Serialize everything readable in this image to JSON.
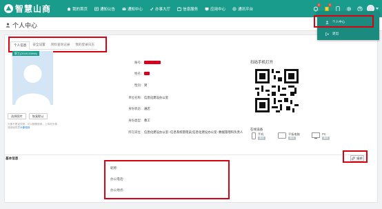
{
  "app": {
    "logo_text": "智慧山商",
    "logo_mark": "⛰"
  },
  "nav": [
    {
      "label": "我的首页",
      "icon": "home-icon"
    },
    {
      "label": "通知公告",
      "icon": "notice-icon"
    },
    {
      "label": "通知中心",
      "icon": "notify-center-icon"
    },
    {
      "label": "办事大厅",
      "icon": "hall-icon"
    },
    {
      "label": "信息服务",
      "icon": "info-service-icon"
    },
    {
      "label": "应用中心",
      "icon": "app-center-icon"
    },
    {
      "label": "通讯平台",
      "icon": "comm-platform-icon"
    }
  ],
  "toolbar": {
    "bell_count": "1",
    "mail_count": "1"
  },
  "page": {
    "title": "个人中心"
  },
  "tabs": [
    {
      "label": "个人信息"
    },
    {
      "label": "安全设置"
    },
    {
      "label": "资料查询记录"
    },
    {
      "label": "我的登录日志"
    }
  ],
  "profile": {
    "photo_tag": "职工(2015133998)",
    "select_photo": "选择图片",
    "restore_default": "恢复默认",
    "note_text": "头像不是证件照，可以随便使用，上传时头像请参阅同意",
    "note_link": "头像规则",
    "fields": [
      {
        "label": "账号:",
        "value": ""
      },
      {
        "label": "姓名:",
        "value": ""
      },
      {
        "label": "性别:",
        "value": "男"
      },
      {
        "label": "单位名称:",
        "value": "信息化建设办公室"
      },
      {
        "label": "身份状态:",
        "value": "通店"
      },
      {
        "label": "身份类型:",
        "value": "教工"
      }
    ],
    "roles_label": "所在岗位:",
    "roles_value": "信息化建设办公室--信息系统管理员(信息化建设办公室--数据管理科负责人"
  },
  "qr": {
    "title": "扫码手机打开"
  },
  "online": {
    "title": "在线设备",
    "devices": [
      {
        "name": "手机",
        "status": "离线",
        "icon": "phone-icon"
      },
      {
        "name": "平板电脑",
        "status": "离线",
        "icon": "tablet-icon"
      },
      {
        "name": "PC",
        "status": "离线",
        "icon": "pc-icon"
      }
    ]
  },
  "base": {
    "title": "基本信息",
    "edit_label": "编辑",
    "fields": [
      {
        "label": "昵称:"
      },
      {
        "label": "办公电话:"
      },
      {
        "label": "办公地点:"
      }
    ]
  },
  "dropdown": {
    "items": [
      {
        "label": "个人中心",
        "icon": "user-icon"
      },
      {
        "label": "退出",
        "icon": "logout-icon"
      }
    ]
  },
  "colors": {
    "brand": "#1a9c8d",
    "highlight": "#d9000f"
  }
}
